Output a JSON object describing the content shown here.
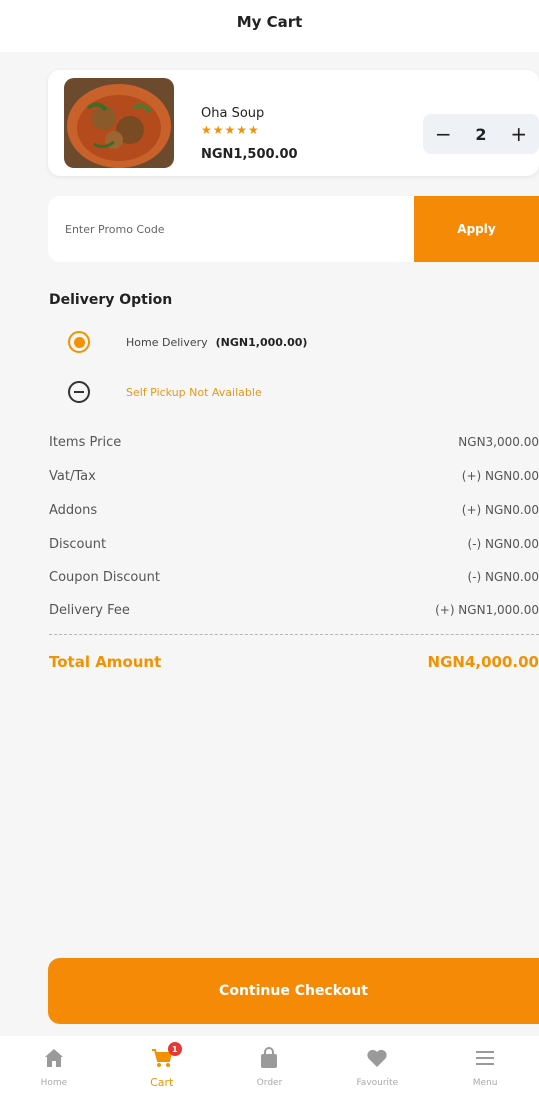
{
  "header": {
    "title": "My Cart"
  },
  "cart_item": {
    "name": "Oha Soup",
    "stars": "★★★★★",
    "rating": 5,
    "price": "NGN1,500.00",
    "quantity": "2",
    "minus": "−",
    "plus": "+"
  },
  "promo": {
    "placeholder": "Enter Promo Code",
    "apply_label": "Apply"
  },
  "delivery": {
    "title": "Delivery Option",
    "home_label": "Home Delivery",
    "home_fee": "(NGN1,000.00)",
    "pickup_label": "Self Pickup Not Available"
  },
  "summary": {
    "rows": [
      {
        "label": "Items Price",
        "value": "NGN3,000.00"
      },
      {
        "label": "Vat/Tax",
        "value": "(+) NGN0.00"
      },
      {
        "label": "Addons",
        "value": "(+) NGN0.00"
      },
      {
        "label": "Discount",
        "value": "(-) NGN0.00"
      },
      {
        "label": "Coupon Discount",
        "value": "(-) NGN0.00"
      },
      {
        "label": "Delivery Fee",
        "value": "(+) NGN1,000.00"
      }
    ],
    "total_label": "Total Amount",
    "total_value": "NGN4,000.00"
  },
  "checkout": {
    "label": "Continue Checkout"
  },
  "bottom_nav": {
    "items": [
      {
        "label": "Home",
        "icon": "home-icon"
      },
      {
        "label": "Cart",
        "icon": "cart-icon",
        "badge": "1"
      },
      {
        "label": "Order",
        "icon": "order-bag-icon"
      },
      {
        "label": "Favourite",
        "icon": "heart-icon"
      },
      {
        "label": "Menu",
        "icon": "menu-icon"
      }
    ]
  },
  "colors": {
    "accent": "#f58a07",
    "star": "#f39200",
    "badge": "#e53935"
  }
}
